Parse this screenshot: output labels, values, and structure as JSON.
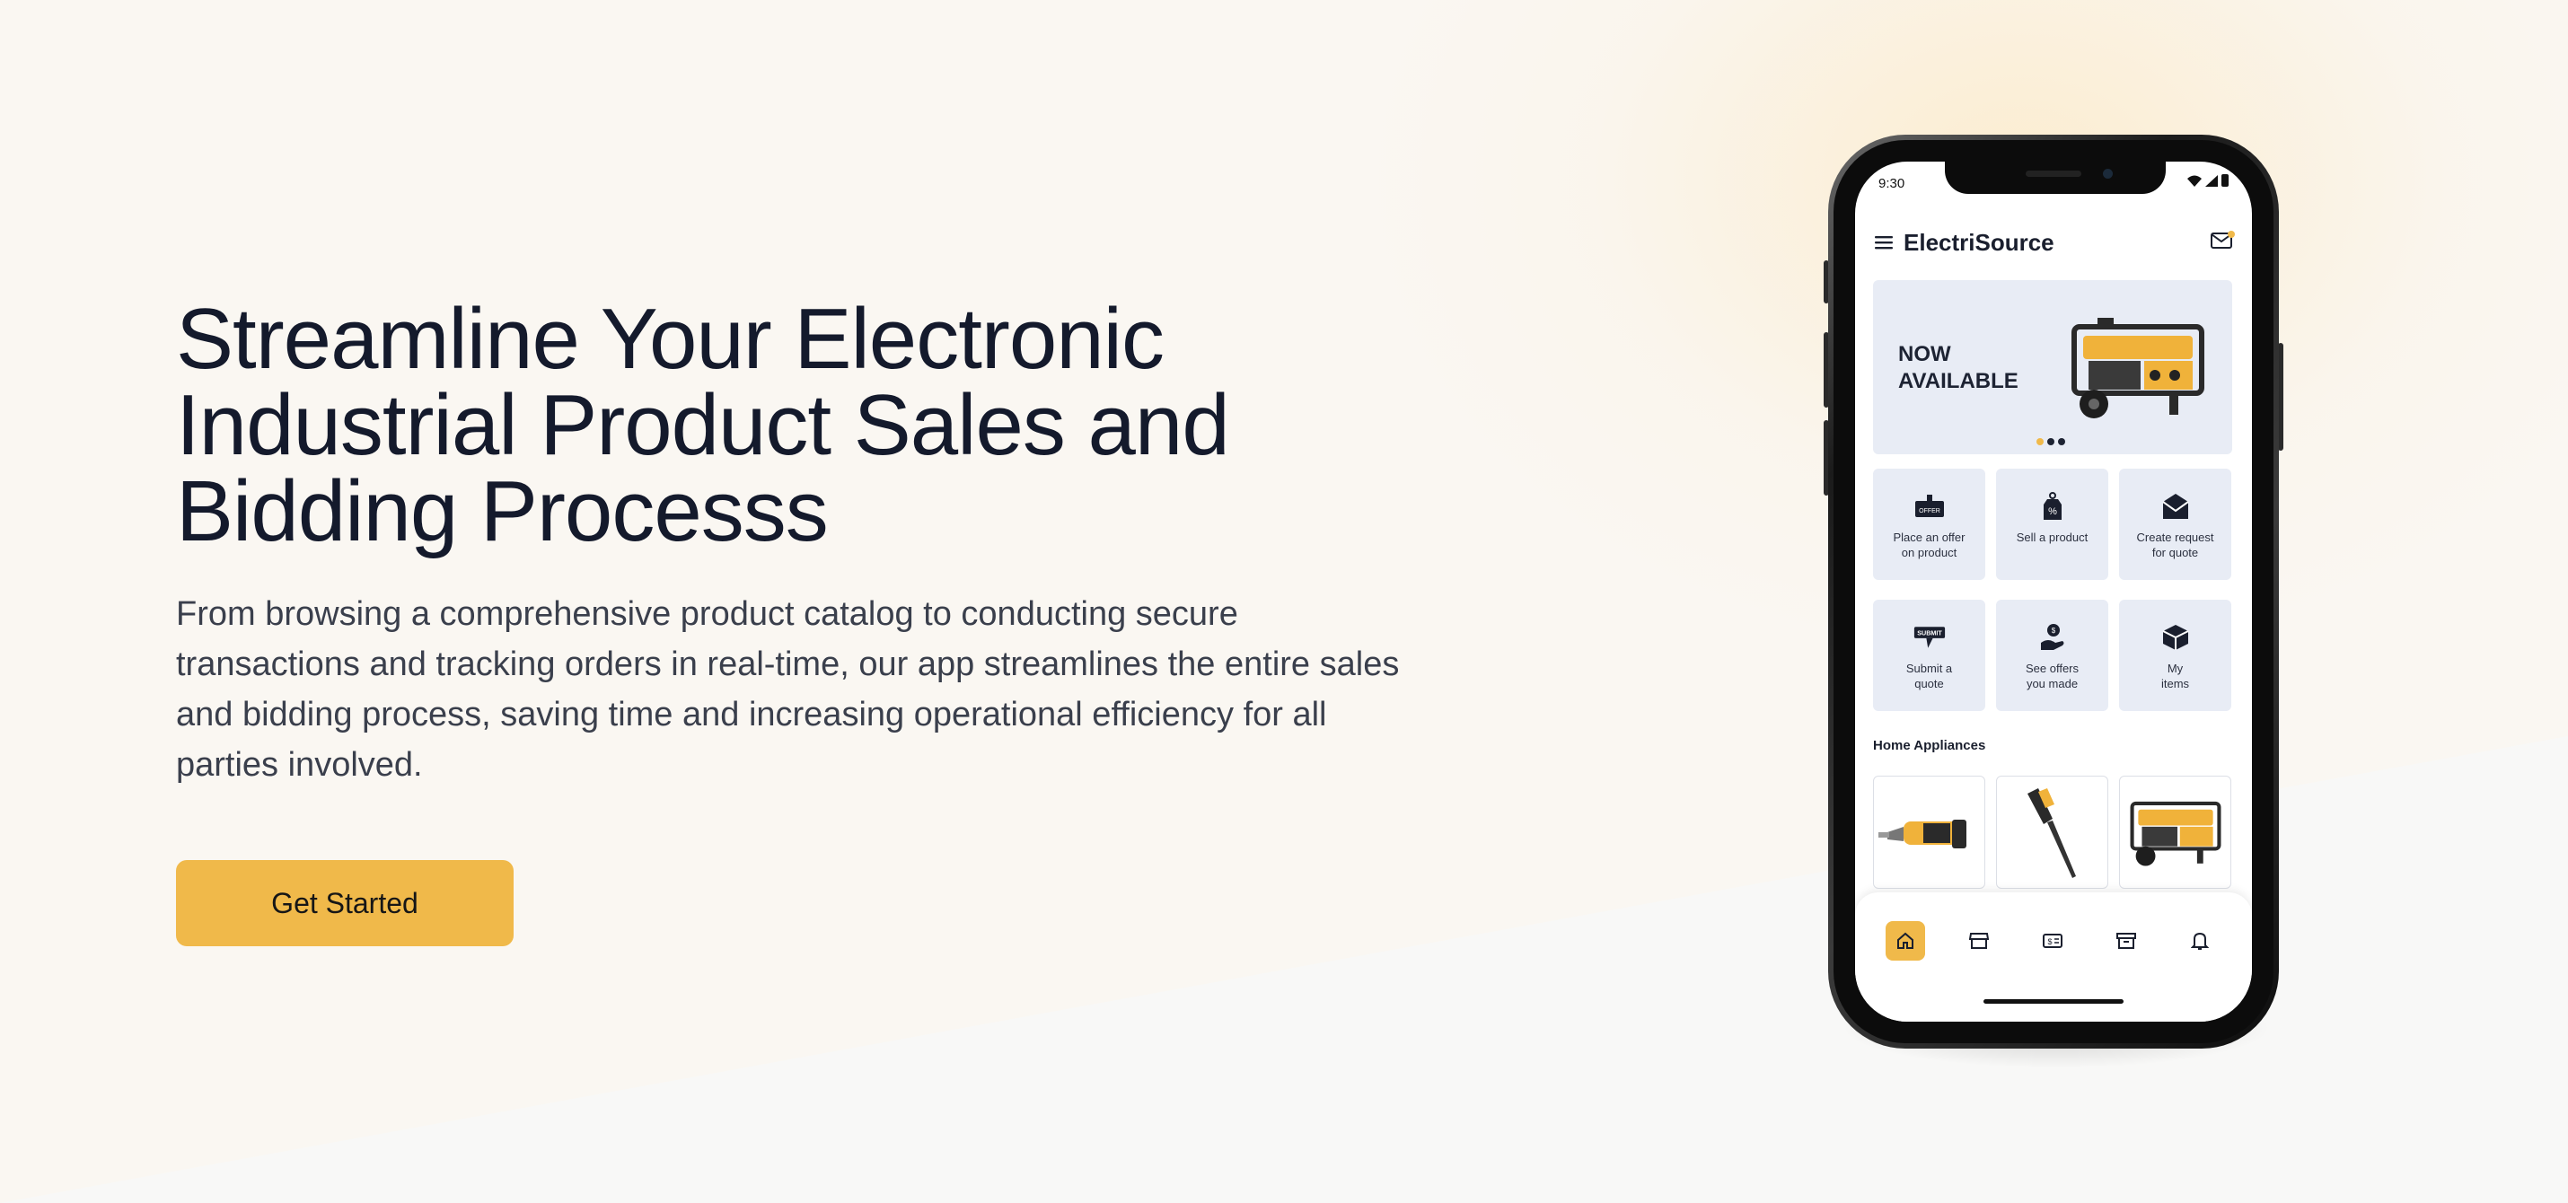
{
  "hero": {
    "title": "Streamline Your Electronic Industrial Product Sales and Bidding Processs",
    "description": "From browsing a comprehensive product catalog to conducting secure transactions and tracking orders in real-time, our app streamlines the entire sales and bidding process, saving time and increasing operational efficiency for all parties involved.",
    "cta_label": "Get Started"
  },
  "colors": {
    "accent": "#f0b94a",
    "heading": "#141a2c",
    "tile_bg": "#e8ecf5",
    "page_bg": "#faf7f2"
  },
  "phone": {
    "status_time": "9:30",
    "app_title": "ElectriSource",
    "banner": {
      "text": "NOW AVAILABLE",
      "image": "generator-image",
      "slides": 3,
      "active_slide": 1
    },
    "actions": [
      {
        "label": "Place an offer\non product",
        "icon": "offer-tag-icon"
      },
      {
        "label": "Sell a product",
        "icon": "percent-tag-icon"
      },
      {
        "label": "Create request\nfor quote",
        "icon": "envelope-icon"
      },
      {
        "label": "Submit a\nquote",
        "icon": "submit-sign-icon"
      },
      {
        "label": "See offers\nyou made",
        "icon": "hand-coin-icon"
      },
      {
        "label": "My\nitems",
        "icon": "box-icon"
      }
    ],
    "section_title": "Home Appliances",
    "products": [
      {
        "name": "oscillating-multitool-image"
      },
      {
        "name": "screwdriver-tool-image"
      },
      {
        "name": "generator-image"
      }
    ],
    "nav": [
      {
        "icon": "home-icon",
        "active": true
      },
      {
        "icon": "store-icon",
        "active": false
      },
      {
        "icon": "bill-icon",
        "active": false
      },
      {
        "icon": "archive-icon",
        "active": false
      },
      {
        "icon": "bell-icon",
        "active": false
      }
    ]
  }
}
